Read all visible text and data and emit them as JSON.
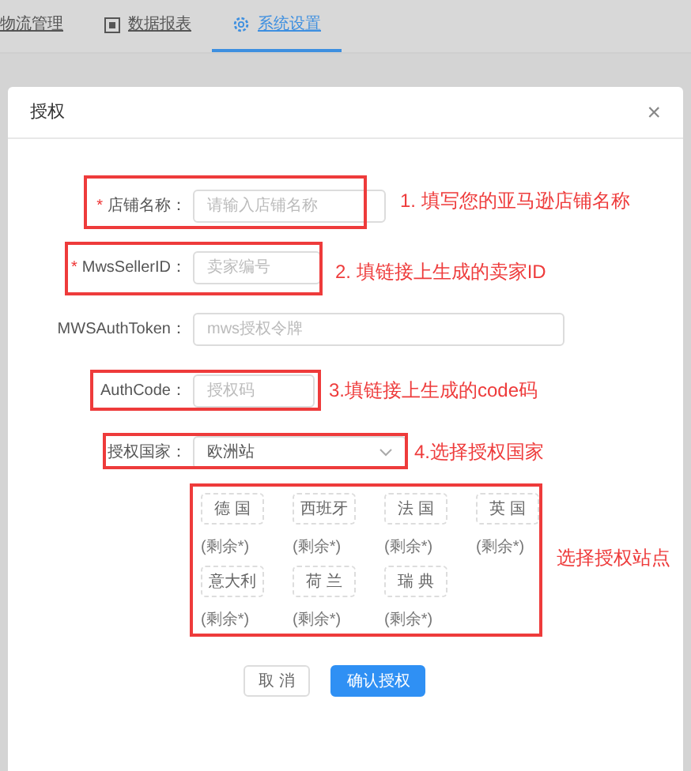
{
  "nav": {
    "tabs": [
      {
        "label": "物流管理",
        "selected": false
      },
      {
        "label": "数据报表",
        "selected": false
      },
      {
        "label": "系统设置",
        "selected": true
      }
    ]
  },
  "dialog": {
    "title": "授权",
    "close": "×",
    "fields": [
      {
        "kind": "text",
        "mark": "*",
        "label": "店铺名称：",
        "placeholder": "请输入店铺名称"
      },
      {
        "kind": "text",
        "mark": "*",
        "label": "MwsSellerID：",
        "placeholder": "卖家编号"
      },
      {
        "kind": "text",
        "label": "MWSAuthToken：",
        "placeholder": "mws授权令牌"
      },
      {
        "kind": "text",
        "label": "AuthCode：",
        "placeholder": "授权码"
      },
      {
        "kind": "select",
        "label": "授权国家：",
        "value": "欧洲站"
      }
    ],
    "stations": [
      {
        "label": "德 国",
        "note": "(剩余*)"
      },
      {
        "label": "西班牙",
        "note": "(剩余*)"
      },
      {
        "label": "法 国",
        "note": "(剩余*)"
      },
      {
        "label": "英 国",
        "note": "(剩余*)"
      },
      {
        "label": "意大利",
        "note": "(剩余*)"
      },
      {
        "label": "荷 兰",
        "note": "(剩余*)"
      },
      {
        "label": "瑞 典",
        "note": "(剩余*)"
      }
    ],
    "buttons": [
      {
        "kind": "cancel",
        "label": "取 消"
      },
      {
        "kind": "confirm",
        "label": "确认授权"
      }
    ]
  },
  "annotations": [
    "1. 填写您的亚马逊店铺名称",
    "2. 填链接上生成的卖家ID",
    "3.填链接上生成的code码",
    "4.选择授权国家",
    "选择授权站点"
  ]
}
